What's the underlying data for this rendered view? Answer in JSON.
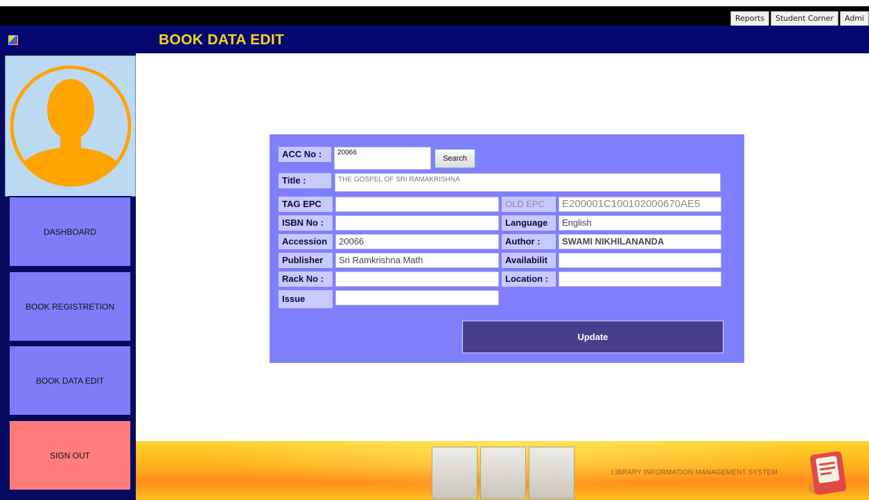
{
  "menu": {
    "items": [
      "Reports",
      "Student Corner",
      "Admi"
    ]
  },
  "header": {
    "title": "BOOK DATA EDIT"
  },
  "sidebar": {
    "items": [
      {
        "label": "DASHBOARD"
      },
      {
        "label": "BOOK REGISTRETION"
      },
      {
        "label": "BOOK DATA EDIT"
      },
      {
        "label": "SIGN OUT"
      }
    ]
  },
  "form": {
    "acc_no": {
      "label": "ACC No :",
      "value": "20066"
    },
    "search_label": "Search",
    "title": {
      "label": "Title :",
      "value": "THE GOSPEL OF SRI RAMAKRISHNA"
    },
    "tag_epc": {
      "label": "TAG EPC",
      "value": ""
    },
    "old_epc": {
      "label": "OLD EPC",
      "value": "E200001C100102000670AE5"
    },
    "isbn": {
      "label": "ISBN No :",
      "value": ""
    },
    "language": {
      "label": "Language",
      "value": "English"
    },
    "accession": {
      "label": "Accession",
      "value": "20066"
    },
    "author": {
      "label": "Author :",
      "value": "SWAMI NIKHILANANDA"
    },
    "publisher": {
      "label": "Publisher",
      "value": "Sri Ramkrishna Math"
    },
    "availability": {
      "label": "Availabilit",
      "value": ""
    },
    "rack_no": {
      "label": "Rack No :",
      "value": ""
    },
    "location": {
      "label": "Location :",
      "value": ""
    },
    "issue": {
      "label": "Issue",
      "value": ""
    },
    "update_label": "Update"
  },
  "footer": {
    "text": "LIBRARY INFORMATION MANAGEMENT SYSTEM"
  },
  "colors": {
    "header_bg": "#020870",
    "title": "#ffd21f",
    "panel": "#8080ff",
    "nav_button": "#7f7cf8",
    "sign_out": "#ff7d7d",
    "update_button": "#483d8b"
  },
  "icons": [
    "app-icon",
    "user-avatar-icon",
    "book-logo-icon"
  ]
}
